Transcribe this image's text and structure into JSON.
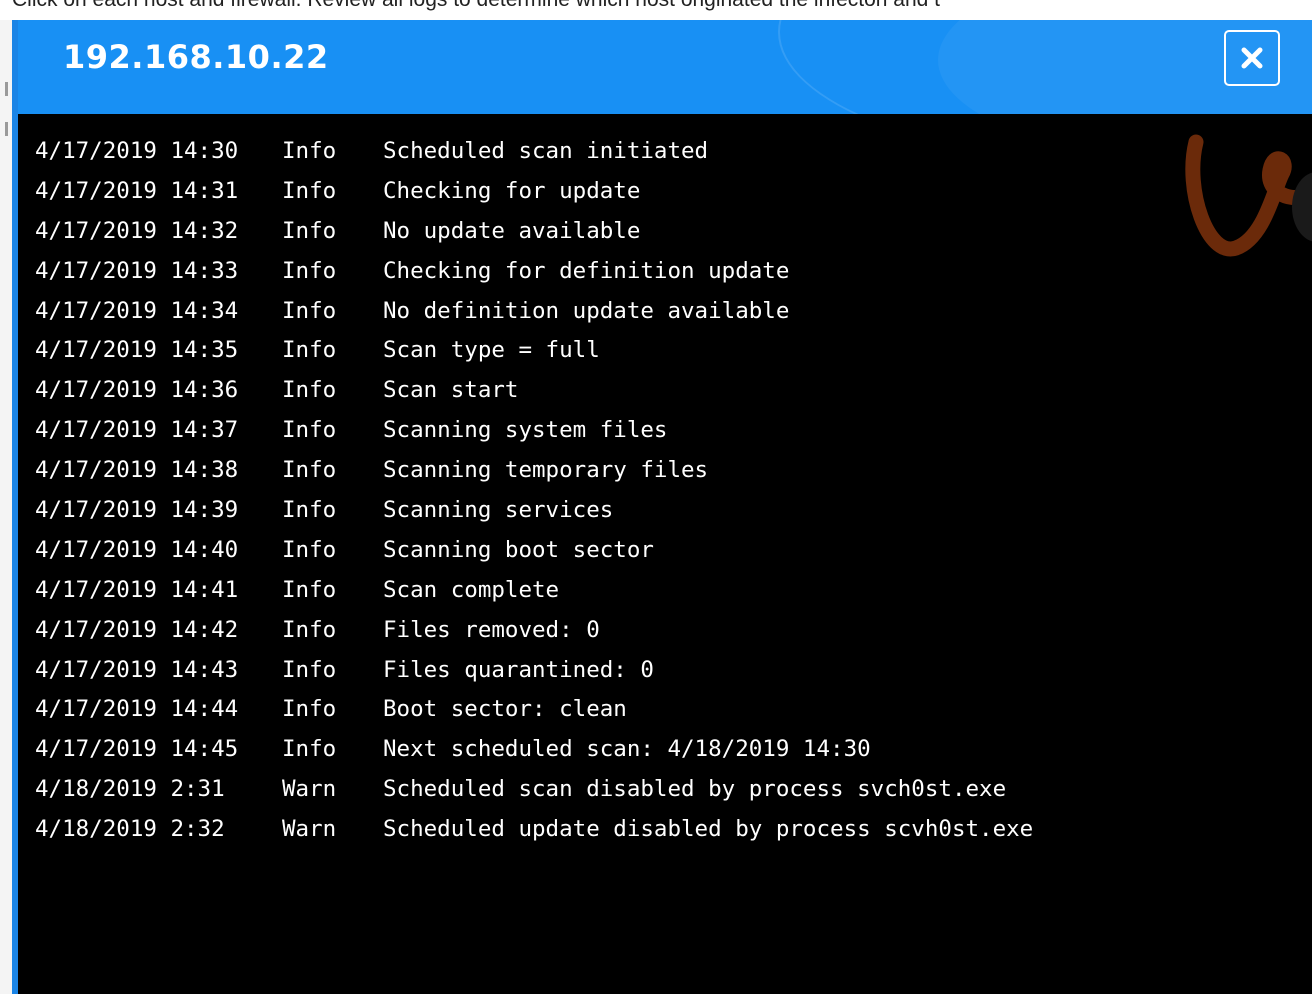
{
  "instruction": "Click on each host and firewall. Review all logs to determine which host originated the infecton and t",
  "dialog": {
    "title": "192.168.10.22",
    "close_icon": "close-icon"
  },
  "log": {
    "entries": [
      {
        "timestamp": "4/17/2019 14:30",
        "level": "Info",
        "message": "Scheduled scan initiated"
      },
      {
        "timestamp": "4/17/2019 14:31",
        "level": "Info",
        "message": "Checking for update"
      },
      {
        "timestamp": "4/17/2019 14:32",
        "level": "Info",
        "message": "No update available"
      },
      {
        "timestamp": "4/17/2019 14:33",
        "level": "Info",
        "message": "Checking for definition update"
      },
      {
        "timestamp": "4/17/2019 14:34",
        "level": "Info",
        "message": "No definition update available"
      },
      {
        "timestamp": "4/17/2019 14:35",
        "level": "Info",
        "message": "Scan type = full"
      },
      {
        "timestamp": "4/17/2019 14:36",
        "level": "Info",
        "message": "Scan start"
      },
      {
        "timestamp": "4/17/2019 14:37",
        "level": "Info",
        "message": "Scanning system files"
      },
      {
        "timestamp": "4/17/2019 14:38",
        "level": "Info",
        "message": "Scanning temporary files"
      },
      {
        "timestamp": "4/17/2019 14:39",
        "level": "Info",
        "message": "Scanning services"
      },
      {
        "timestamp": "4/17/2019 14:40",
        "level": "Info",
        "message": "Scanning boot sector"
      },
      {
        "timestamp": "4/17/2019 14:41",
        "level": "Info",
        "message": "Scan complete"
      },
      {
        "timestamp": "4/17/2019 14:42",
        "level": "Info",
        "message": "Files removed: 0"
      },
      {
        "timestamp": "4/17/2019 14:43",
        "level": "Info",
        "message": "Files quarantined: 0"
      },
      {
        "timestamp": "4/17/2019 14:44",
        "level": "Info",
        "message": "Boot sector: clean"
      },
      {
        "timestamp": "4/17/2019 14:45",
        "level": "Info",
        "message": "Next scheduled scan: 4/18/2019 14:30"
      },
      {
        "timestamp": "4/18/2019 2:31",
        "level": "Warn",
        "message": "Scheduled scan disabled by process svch0st.exe"
      },
      {
        "timestamp": "4/18/2019 2:32",
        "level": "Warn",
        "message": "Scheduled update disabled by process scvh0st.exe"
      }
    ]
  },
  "colors": {
    "titlebar": "#1890f4",
    "log_background": "#000000",
    "log_text": "#ffffff",
    "watermark": "#6b2a0a"
  }
}
